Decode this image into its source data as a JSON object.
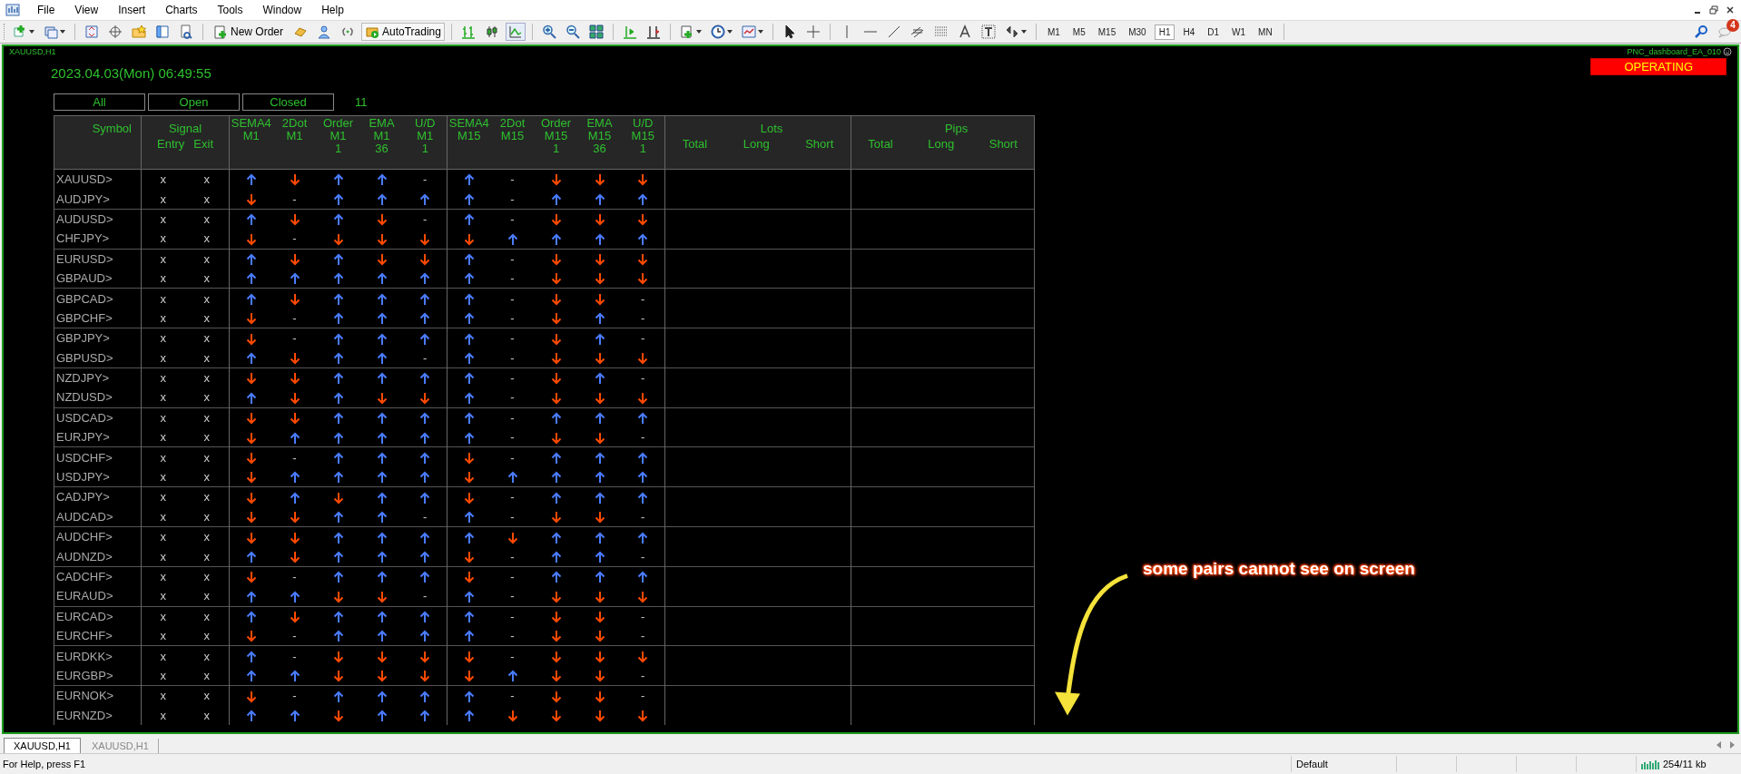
{
  "menu": [
    "File",
    "View",
    "Insert",
    "Charts",
    "Tools",
    "Window",
    "Help"
  ],
  "toolbar": {
    "new_order": "New Order",
    "auto_trading": "AutoTrading",
    "timeframes": [
      {
        "label": "M1",
        "selected": false
      },
      {
        "label": "M5",
        "selected": false
      },
      {
        "label": "M15",
        "selected": false
      },
      {
        "label": "M30",
        "selected": false
      },
      {
        "label": "H1",
        "selected": true
      },
      {
        "label": "H4",
        "selected": false
      },
      {
        "label": "D1",
        "selected": false
      },
      {
        "label": "W1",
        "selected": false
      },
      {
        "label": "MN",
        "selected": false
      }
    ]
  },
  "notifications": {
    "count": "4"
  },
  "chart": {
    "title": "XAUUSD,H1",
    "expert": "PNC_dashboard_EA_010",
    "status": "OPERATING",
    "datetime": "2023.04.03(Mon) 06:49:55",
    "filters": [
      {
        "label": "All"
      },
      {
        "label": "Open"
      },
      {
        "label": "Closed"
      }
    ],
    "count": "11",
    "table": {
      "headers": {
        "symbol": "Symbol",
        "signal": {
          "title": "Signal",
          "sub": [
            "Entry",
            "Exit"
          ]
        },
        "indicators": [
          {
            "lines": [
              "SEMA4",
              "M1"
            ]
          },
          {
            "lines": [
              "2Dot",
              "M1"
            ]
          },
          {
            "lines": [
              "Order",
              "M1",
              "1"
            ]
          },
          {
            "lines": [
              "EMA",
              "M1",
              "36"
            ]
          },
          {
            "lines": [
              "U/D",
              "M1",
              "1"
            ]
          },
          {
            "lines": [
              "SEMA4",
              "M15"
            ]
          },
          {
            "lines": [
              "2Dot",
              "M15"
            ]
          },
          {
            "lines": [
              "Order",
              "M15",
              "1"
            ]
          },
          {
            "lines": [
              "EMA",
              "M15",
              "36"
            ]
          },
          {
            "lines": [
              "U/D",
              "M15",
              "1"
            ]
          }
        ],
        "lots": {
          "title": "Lots",
          "sub": [
            "Total",
            "Long",
            "Short"
          ]
        },
        "pips": {
          "title": "Pips",
          "sub": [
            "Total",
            "Long",
            "Short"
          ]
        }
      },
      "rows": [
        {
          "symbol": "XAUUSD>",
          "entry": "x",
          "exit": "x",
          "signals": [
            {
              "kind": "up"
            },
            {
              "kind": "down"
            },
            {
              "kind": "up"
            },
            {
              "kind": "up"
            },
            {
              "kind": "text",
              "text": "-"
            },
            {
              "kind": "up"
            },
            {
              "kind": "text",
              "text": "-"
            },
            {
              "kind": "down"
            },
            {
              "kind": "down"
            },
            {
              "kind": "down"
            }
          ]
        },
        {
          "symbol": "AUDJPY>",
          "entry": "x",
          "exit": "x",
          "signals": [
            {
              "kind": "down"
            },
            {
              "kind": "text",
              "text": "-"
            },
            {
              "kind": "up"
            },
            {
              "kind": "up"
            },
            {
              "kind": "up"
            },
            {
              "kind": "up"
            },
            {
              "kind": "text",
              "text": "-"
            },
            {
              "kind": "up"
            },
            {
              "kind": "up"
            },
            {
              "kind": "up"
            }
          ]
        },
        {
          "symbol": "AUDUSD>",
          "entry": "x",
          "exit": "x",
          "signals": [
            {
              "kind": "up"
            },
            {
              "kind": "down"
            },
            {
              "kind": "up"
            },
            {
              "kind": "down"
            },
            {
              "kind": "text",
              "text": "-"
            },
            {
              "kind": "up"
            },
            {
              "kind": "text",
              "text": "-"
            },
            {
              "kind": "down"
            },
            {
              "kind": "down"
            },
            {
              "kind": "down"
            }
          ]
        },
        {
          "symbol": "CHFJPY>",
          "entry": "x",
          "exit": "x",
          "signals": [
            {
              "kind": "down"
            },
            {
              "kind": "text",
              "text": "-"
            },
            {
              "kind": "down"
            },
            {
              "kind": "down"
            },
            {
              "kind": "down"
            },
            {
              "kind": "down"
            },
            {
              "kind": "up"
            },
            {
              "kind": "up"
            },
            {
              "kind": "up"
            },
            {
              "kind": "up"
            }
          ]
        },
        {
          "symbol": "EURUSD>",
          "entry": "x",
          "exit": "x",
          "signals": [
            {
              "kind": "up"
            },
            {
              "kind": "down"
            },
            {
              "kind": "up"
            },
            {
              "kind": "down"
            },
            {
              "kind": "down"
            },
            {
              "kind": "up"
            },
            {
              "kind": "text",
              "text": "-"
            },
            {
              "kind": "down"
            },
            {
              "kind": "down"
            },
            {
              "kind": "down"
            }
          ]
        },
        {
          "symbol": "GBPAUD>",
          "entry": "x",
          "exit": "x",
          "signals": [
            {
              "kind": "up"
            },
            {
              "kind": "up"
            },
            {
              "kind": "up"
            },
            {
              "kind": "up"
            },
            {
              "kind": "up"
            },
            {
              "kind": "up"
            },
            {
              "kind": "text",
              "text": "-"
            },
            {
              "kind": "down"
            },
            {
              "kind": "down"
            },
            {
              "kind": "down"
            }
          ]
        },
        {
          "symbol": "GBPCAD>",
          "entry": "x",
          "exit": "x",
          "signals": [
            {
              "kind": "up"
            },
            {
              "kind": "down"
            },
            {
              "kind": "up"
            },
            {
              "kind": "up"
            },
            {
              "kind": "up"
            },
            {
              "kind": "up"
            },
            {
              "kind": "text",
              "text": "-"
            },
            {
              "kind": "down"
            },
            {
              "kind": "down"
            },
            {
              "kind": "text",
              "text": "-"
            }
          ]
        },
        {
          "symbol": "GBPCHF>",
          "entry": "x",
          "exit": "x",
          "signals": [
            {
              "kind": "down"
            },
            {
              "kind": "text",
              "text": "-"
            },
            {
              "kind": "up"
            },
            {
              "kind": "up"
            },
            {
              "kind": "up"
            },
            {
              "kind": "up"
            },
            {
              "kind": "text",
              "text": "-"
            },
            {
              "kind": "down"
            },
            {
              "kind": "up"
            },
            {
              "kind": "text",
              "text": "-"
            }
          ]
        },
        {
          "symbol": "GBPJPY>",
          "entry": "x",
          "exit": "x",
          "signals": [
            {
              "kind": "down"
            },
            {
              "kind": "text",
              "text": "-"
            },
            {
              "kind": "up"
            },
            {
              "kind": "up"
            },
            {
              "kind": "up"
            },
            {
              "kind": "up"
            },
            {
              "kind": "text",
              "text": "-"
            },
            {
              "kind": "down"
            },
            {
              "kind": "up"
            },
            {
              "kind": "text",
              "text": "-"
            }
          ]
        },
        {
          "symbol": "GBPUSD>",
          "entry": "x",
          "exit": "x",
          "signals": [
            {
              "kind": "up"
            },
            {
              "kind": "down"
            },
            {
              "kind": "up"
            },
            {
              "kind": "up"
            },
            {
              "kind": "text",
              "text": "-"
            },
            {
              "kind": "up"
            },
            {
              "kind": "text",
              "text": "-"
            },
            {
              "kind": "down"
            },
            {
              "kind": "down"
            },
            {
              "kind": "down"
            }
          ]
        },
        {
          "symbol": "NZDJPY>",
          "entry": "x",
          "exit": "x",
          "signals": [
            {
              "kind": "down"
            },
            {
              "kind": "down"
            },
            {
              "kind": "up"
            },
            {
              "kind": "up"
            },
            {
              "kind": "up"
            },
            {
              "kind": "up"
            },
            {
              "kind": "text",
              "text": "-"
            },
            {
              "kind": "down"
            },
            {
              "kind": "up"
            },
            {
              "kind": "text",
              "text": "-"
            }
          ]
        },
        {
          "symbol": "NZDUSD>",
          "entry": "x",
          "exit": "x",
          "signals": [
            {
              "kind": "up"
            },
            {
              "kind": "down"
            },
            {
              "kind": "up"
            },
            {
              "kind": "down"
            },
            {
              "kind": "down"
            },
            {
              "kind": "up"
            },
            {
              "kind": "text",
              "text": "-"
            },
            {
              "kind": "down"
            },
            {
              "kind": "down"
            },
            {
              "kind": "down"
            }
          ]
        },
        {
          "symbol": "USDCAD>",
          "entry": "x",
          "exit": "x",
          "signals": [
            {
              "kind": "down"
            },
            {
              "kind": "down"
            },
            {
              "kind": "up"
            },
            {
              "kind": "up"
            },
            {
              "kind": "up"
            },
            {
              "kind": "up"
            },
            {
              "kind": "text",
              "text": "-"
            },
            {
              "kind": "up"
            },
            {
              "kind": "up"
            },
            {
              "kind": "up"
            }
          ]
        },
        {
          "symbol": "EURJPY>",
          "entry": "x",
          "exit": "x",
          "signals": [
            {
              "kind": "down"
            },
            {
              "kind": "up"
            },
            {
              "kind": "up"
            },
            {
              "kind": "up"
            },
            {
              "kind": "up"
            },
            {
              "kind": "up"
            },
            {
              "kind": "text",
              "text": "-"
            },
            {
              "kind": "down"
            },
            {
              "kind": "down"
            },
            {
              "kind": "text",
              "text": "-"
            }
          ]
        },
        {
          "symbol": "USDCHF>",
          "entry": "x",
          "exit": "x",
          "signals": [
            {
              "kind": "down"
            },
            {
              "kind": "text",
              "text": "-"
            },
            {
              "kind": "up"
            },
            {
              "kind": "up"
            },
            {
              "kind": "up"
            },
            {
              "kind": "down"
            },
            {
              "kind": "text",
              "text": "-"
            },
            {
              "kind": "up"
            },
            {
              "kind": "up"
            },
            {
              "kind": "up"
            }
          ]
        },
        {
          "symbol": "USDJPY>",
          "entry": "x",
          "exit": "x",
          "signals": [
            {
              "kind": "down"
            },
            {
              "kind": "up"
            },
            {
              "kind": "up"
            },
            {
              "kind": "up"
            },
            {
              "kind": "up"
            },
            {
              "kind": "down"
            },
            {
              "kind": "up"
            },
            {
              "kind": "up"
            },
            {
              "kind": "up"
            },
            {
              "kind": "up"
            }
          ]
        },
        {
          "symbol": "CADJPY>",
          "entry": "x",
          "exit": "x",
          "signals": [
            {
              "kind": "down"
            },
            {
              "kind": "up"
            },
            {
              "kind": "down"
            },
            {
              "kind": "up"
            },
            {
              "kind": "up"
            },
            {
              "kind": "down"
            },
            {
              "kind": "text",
              "text": "-"
            },
            {
              "kind": "up"
            },
            {
              "kind": "up"
            },
            {
              "kind": "up"
            }
          ]
        },
        {
          "symbol": "AUDCAD>",
          "entry": "x",
          "exit": "x",
          "signals": [
            {
              "kind": "down"
            },
            {
              "kind": "down"
            },
            {
              "kind": "up"
            },
            {
              "kind": "up"
            },
            {
              "kind": "text",
              "text": "-"
            },
            {
              "kind": "up"
            },
            {
              "kind": "text",
              "text": "-"
            },
            {
              "kind": "down"
            },
            {
              "kind": "down"
            },
            {
              "kind": "text",
              "text": "-"
            }
          ]
        },
        {
          "symbol": "AUDCHF>",
          "entry": "x",
          "exit": "x",
          "signals": [
            {
              "kind": "down"
            },
            {
              "kind": "down"
            },
            {
              "kind": "up"
            },
            {
              "kind": "up"
            },
            {
              "kind": "up"
            },
            {
              "kind": "up"
            },
            {
              "kind": "down"
            },
            {
              "kind": "up"
            },
            {
              "kind": "up"
            },
            {
              "kind": "up"
            }
          ]
        },
        {
          "symbol": "AUDNZD>",
          "entry": "x",
          "exit": "x",
          "signals": [
            {
              "kind": "up"
            },
            {
              "kind": "down"
            },
            {
              "kind": "up"
            },
            {
              "kind": "up"
            },
            {
              "kind": "up"
            },
            {
              "kind": "down"
            },
            {
              "kind": "text",
              "text": "-"
            },
            {
              "kind": "up"
            },
            {
              "kind": "up"
            },
            {
              "kind": "text",
              "text": "-"
            }
          ]
        },
        {
          "symbol": "CADCHF>",
          "entry": "x",
          "exit": "x",
          "signals": [
            {
              "kind": "down"
            },
            {
              "kind": "text",
              "text": "-"
            },
            {
              "kind": "up"
            },
            {
              "kind": "up"
            },
            {
              "kind": "up"
            },
            {
              "kind": "down"
            },
            {
              "kind": "text",
              "text": "-"
            },
            {
              "kind": "up"
            },
            {
              "kind": "up"
            },
            {
              "kind": "up"
            }
          ]
        },
        {
          "symbol": "EURAUD>",
          "entry": "x",
          "exit": "x",
          "signals": [
            {
              "kind": "up"
            },
            {
              "kind": "up"
            },
            {
              "kind": "down"
            },
            {
              "kind": "down"
            },
            {
              "kind": "text",
              "text": "-"
            },
            {
              "kind": "up"
            },
            {
              "kind": "text",
              "text": "-"
            },
            {
              "kind": "down"
            },
            {
              "kind": "down"
            },
            {
              "kind": "down"
            }
          ]
        },
        {
          "symbol": "EURCAD>",
          "entry": "x",
          "exit": "x",
          "signals": [
            {
              "kind": "up"
            },
            {
              "kind": "down"
            },
            {
              "kind": "up"
            },
            {
              "kind": "up"
            },
            {
              "kind": "up"
            },
            {
              "kind": "up"
            },
            {
              "kind": "text",
              "text": "-"
            },
            {
              "kind": "down"
            },
            {
              "kind": "down"
            },
            {
              "kind": "text",
              "text": "-"
            }
          ]
        },
        {
          "symbol": "EURCHF>",
          "entry": "x",
          "exit": "x",
          "signals": [
            {
              "kind": "down"
            },
            {
              "kind": "text",
              "text": "-"
            },
            {
              "kind": "up"
            },
            {
              "kind": "up"
            },
            {
              "kind": "up"
            },
            {
              "kind": "up"
            },
            {
              "kind": "text",
              "text": "-"
            },
            {
              "kind": "down"
            },
            {
              "kind": "down"
            },
            {
              "kind": "text",
              "text": "-"
            }
          ]
        },
        {
          "symbol": "EURDKK>",
          "entry": "x",
          "exit": "x",
          "signals": [
            {
              "kind": "up"
            },
            {
              "kind": "text",
              "text": "-"
            },
            {
              "kind": "down"
            },
            {
              "kind": "down"
            },
            {
              "kind": "down"
            },
            {
              "kind": "down"
            },
            {
              "kind": "text",
              "text": "-"
            },
            {
              "kind": "down"
            },
            {
              "kind": "down"
            },
            {
              "kind": "down"
            }
          ]
        },
        {
          "symbol": "EURGBP>",
          "entry": "x",
          "exit": "x",
          "signals": [
            {
              "kind": "up"
            },
            {
              "kind": "up"
            },
            {
              "kind": "down"
            },
            {
              "kind": "down"
            },
            {
              "kind": "down"
            },
            {
              "kind": "down"
            },
            {
              "kind": "up"
            },
            {
              "kind": "down"
            },
            {
              "kind": "down"
            },
            {
              "kind": "text",
              "text": "-"
            }
          ]
        },
        {
          "symbol": "EURNOK>",
          "entry": "x",
          "exit": "x",
          "signals": [
            {
              "kind": "down"
            },
            {
              "kind": "text",
              "text": "-"
            },
            {
              "kind": "up"
            },
            {
              "kind": "up"
            },
            {
              "kind": "up"
            },
            {
              "kind": "up"
            },
            {
              "kind": "text",
              "text": "-"
            },
            {
              "kind": "down"
            },
            {
              "kind": "down"
            },
            {
              "kind": "text",
              "text": "-"
            }
          ]
        },
        {
          "symbol": "EURNZD>",
          "entry": "x",
          "exit": "x",
          "signals": [
            {
              "kind": "up"
            },
            {
              "kind": "up"
            },
            {
              "kind": "down"
            },
            {
              "kind": "up"
            },
            {
              "kind": "up"
            },
            {
              "kind": "up"
            },
            {
              "kind": "down"
            },
            {
              "kind": "down"
            },
            {
              "kind": "down"
            },
            {
              "kind": "down"
            }
          ]
        }
      ]
    }
  },
  "annotation": {
    "text": "some pairs cannot see on screen"
  },
  "tabs": [
    {
      "label": "XAUUSD,H1",
      "selected": true
    },
    {
      "label": "XAUUSD,H1",
      "selected": false
    }
  ],
  "status_bar": {
    "help": "For Help, press F1",
    "profile": "Default",
    "traffic": "254/11 kb"
  }
}
